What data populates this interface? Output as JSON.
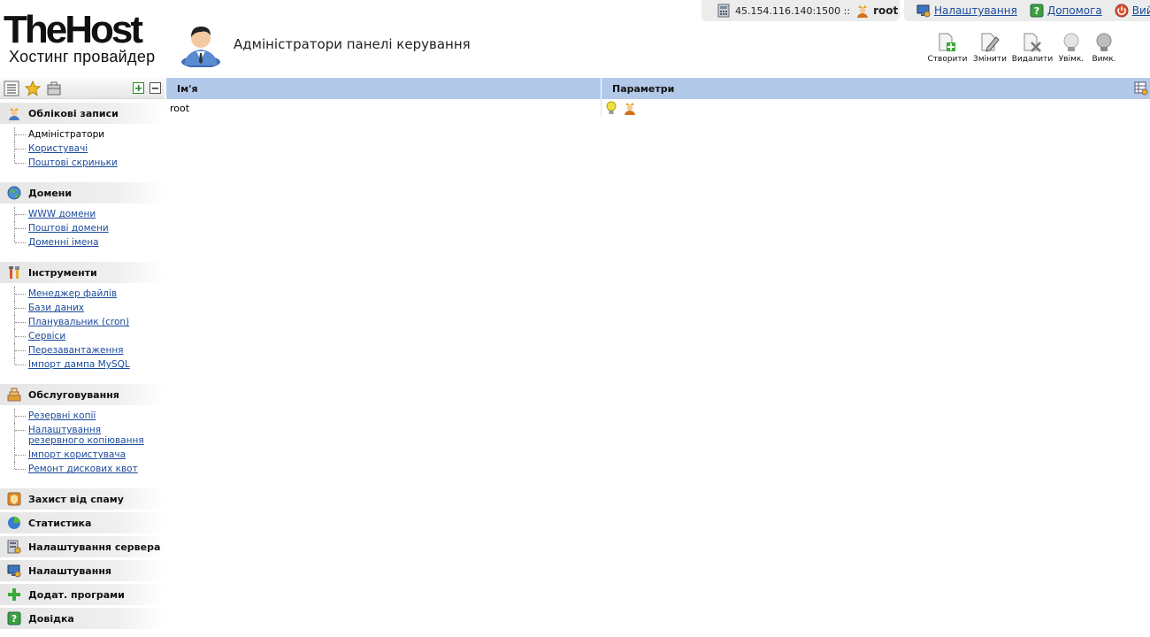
{
  "brand": {
    "logo_main": "TheHost",
    "logo_sub": "Хостинг провайдер"
  },
  "page": {
    "title": "Адміністратори панелі керування"
  },
  "server": {
    "address": "45.154.116.140:1500 ::",
    "user": "root"
  },
  "top_links": [
    {
      "label": "Налаштування",
      "icon": "settings-monitor-icon"
    },
    {
      "label": "Допомога",
      "icon": "help-icon"
    },
    {
      "label": "Вийти",
      "icon": "power-icon"
    }
  ],
  "toolbar": {
    "create": "Створити",
    "edit": "Змінити",
    "delete": "Видалити",
    "enable": "Увімк.",
    "disable": "Вимк."
  },
  "sidebar": {
    "accounts": {
      "title": "Облікові записи",
      "items": [
        "Адміністратори",
        "Користувачі",
        "Поштові скриньки"
      ]
    },
    "domains": {
      "title": "Домени",
      "items": [
        "WWW домени",
        "Поштові домени",
        "Доменні імена"
      ]
    },
    "tools": {
      "title": "Інструменти",
      "items": [
        "Менеджер файлів",
        "Бази даних",
        "Планувальник (cron)",
        "Сервіси",
        "Перезавантаження",
        "Імпорт дампа MySQL"
      ]
    },
    "service": {
      "title": "Обслуговування",
      "items": [
        "Резервні копії",
        "Налаштування резервного копіювання",
        "Імпорт користувача",
        "Ремонт дискових квот"
      ]
    },
    "collapsed": [
      "Захист від спаму",
      "Статистика",
      "Налаштування сервера",
      "Налаштування",
      "Додат. програми",
      "Довідка"
    ]
  },
  "table": {
    "columns": {
      "name": "Ім'я",
      "params": "Параметри"
    },
    "rows": [
      {
        "name": "root"
      }
    ]
  },
  "colors": {
    "header_blue": "#b3c9e9",
    "link": "#1a4a9a"
  }
}
